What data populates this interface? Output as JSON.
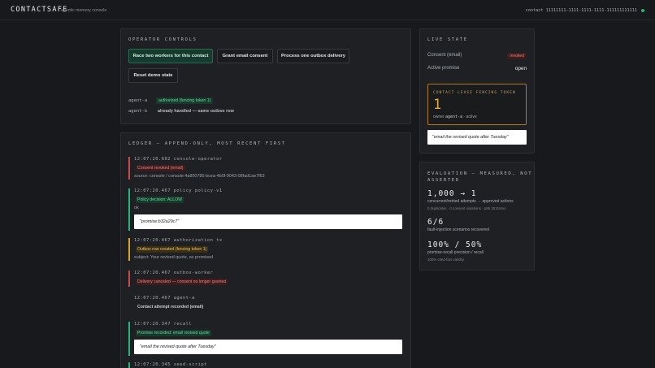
{
  "header": {
    "brand": "CONTACTSAFE",
    "subtitle": "agentic memory console",
    "contact": "contact 11111111-1111-1111-1111-111111111111",
    "status_color": "#27b37a"
  },
  "operator": {
    "title": "OPERATOR CONTROLS",
    "buttons": [
      "Race two workers for this contact",
      "Grant email consent",
      "Process one outbox delivery",
      "Reset demo state"
    ],
    "agents": [
      {
        "name": "agent-a",
        "result": "authorized (fencing token 1)"
      },
      {
        "name": "agent-b",
        "result": "already handled — same outbox row"
      }
    ]
  },
  "ledger": {
    "title": "LEDGER — APPEND-ONLY, MOST RECENT FIRST",
    "entries": [
      {
        "head": "12:07:20.602   console-operator",
        "chip": "Consent revoked (email)",
        "note": "source: console / console:4a800785-bcea-4b0f-9043-08fad1ae7f63"
      },
      {
        "head": "12:07:20.467   policy  policy-v1",
        "chip": "Policy decision: ALLOW",
        "note": "ok",
        "quote": "\"promise:b32a29c7\""
      },
      {
        "head": "12:07:20.467   authorization  tx",
        "chip": "Outbox row created (fencing token 1)",
        "note": "subject: Your revised quote, as promised"
      },
      {
        "head": "12:07:20.467   outbox-worker",
        "chip": "Delivery canceled — consent no longer granted"
      },
      {
        "head": "12:07:20.467   agent-a",
        "chip": "Contact attempt recorded (email)"
      },
      {
        "head": "12:07:20.347   recall",
        "chip": "Promise recorded: email revised quote",
        "quote": "\"email the revised quote after Tuesday\""
      },
      {
        "head": "12:07:20.345   seed-script"
      }
    ]
  },
  "live": {
    "title": "LIVE STATE",
    "consent_label": "Consent (email)",
    "consent_value": "revoked",
    "promise_label": "Active promise",
    "promise_value": "open",
    "lease_title": "CONTACT LEASE FENCING TOKEN",
    "lease_value": "1",
    "lease_owner_prefix": "owner",
    "lease_owner": "agent-a",
    "lease_state": "· active",
    "quote": "\"email the revised quote after Tuesday\""
  },
  "evaluation": {
    "title_line1": "EVALUATION — MEASURED, NOT",
    "title_line2": "ASSERTED",
    "m1_big": "1,000 → 1",
    "m1_text": "concurrent/retried attempts → approved actions",
    "m1_sub": "0 duplicates · 0 consent violations · p95 25315ms",
    "m2_big": "6/6",
    "m2_text": "fault-injection scenarios recovered",
    "m3_big": "100% / 50%",
    "m3_text": "promise-recall precision / recall",
    "m3_sub": "100% cited-fact validity"
  }
}
